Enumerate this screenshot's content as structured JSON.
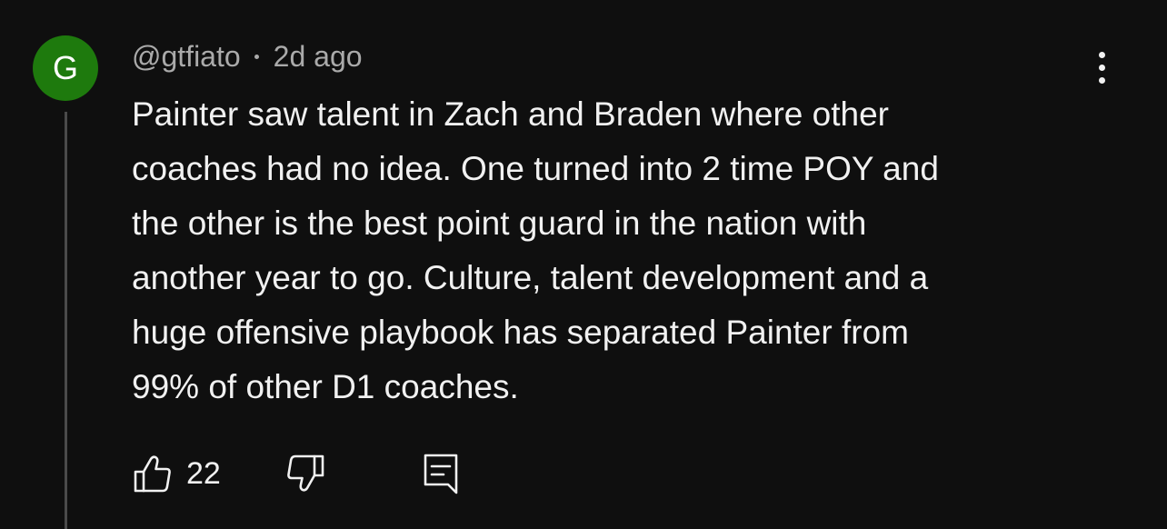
{
  "comment": {
    "avatar_letter": "G",
    "avatar_color": "#1e7a0d",
    "author": "@gtfiato",
    "separator": "•",
    "time": "2d ago",
    "lines": [
      "Painter saw talent in Zach and Braden where other",
      "coaches had no idea. One turned into 2 time POY and",
      "the other is the best point guard in the nation with",
      "another year to go. Culture, talent development and a",
      "huge offensive playbook has separated Painter from",
      "99% of other D1 coaches."
    ],
    "like_count": "22",
    "icons": {
      "like": "thumbs-up-icon",
      "dislike": "thumbs-down-icon",
      "reply": "reply-comment-icon",
      "more": "more-vertical-icon"
    }
  }
}
